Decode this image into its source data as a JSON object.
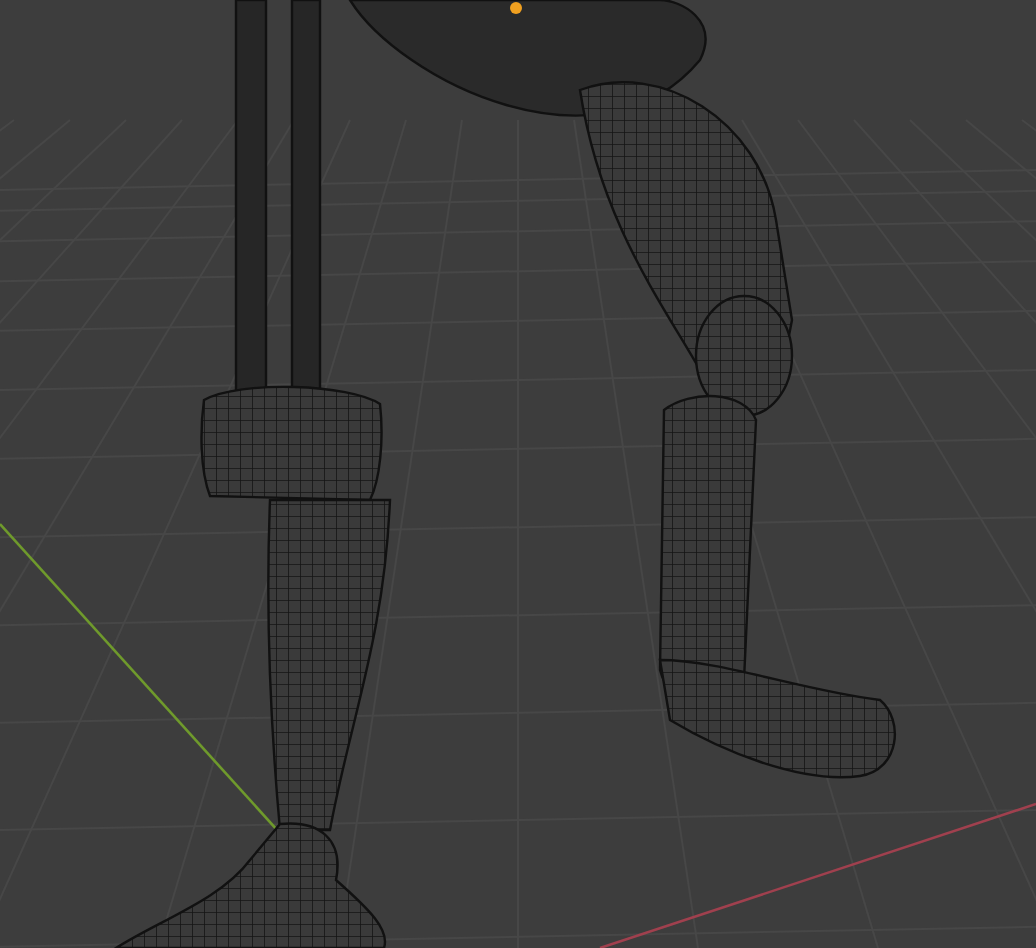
{
  "viewport": {
    "axis_lines": [
      {
        "kind": "horizontal",
        "color": "#a0404e"
      },
      {
        "kind": "depth",
        "color": "#6f9a2c"
      }
    ]
  }
}
